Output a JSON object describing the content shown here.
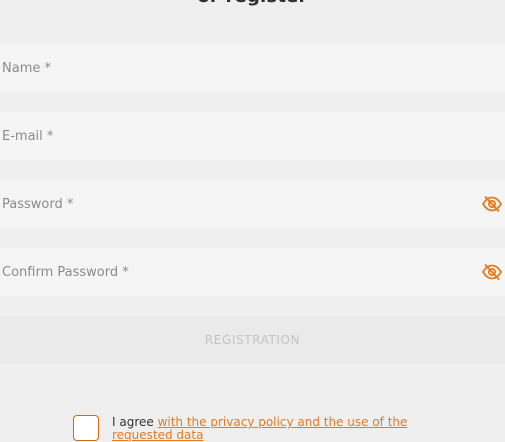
{
  "form": {
    "heading": "or register",
    "fields": [
      {
        "placeholder": "Name *",
        "value": ""
      },
      {
        "placeholder": "E-mail *",
        "value": ""
      },
      {
        "placeholder": "Password *",
        "value": "",
        "icon": "eye-slash-icon"
      },
      {
        "placeholder": "Confirm Password *",
        "value": "",
        "icon": "eye-slash-icon"
      }
    ],
    "submit_label": "REGISTRATION",
    "agree": {
      "prefix": "I agree ",
      "link": "with the privacy policy and the use of the requested data"
    }
  },
  "colors": {
    "accent": "#e67a1e",
    "field_bg": "#f5f5f5",
    "page_bg": "#efefef",
    "disabled_text": "#c4c4c4"
  }
}
